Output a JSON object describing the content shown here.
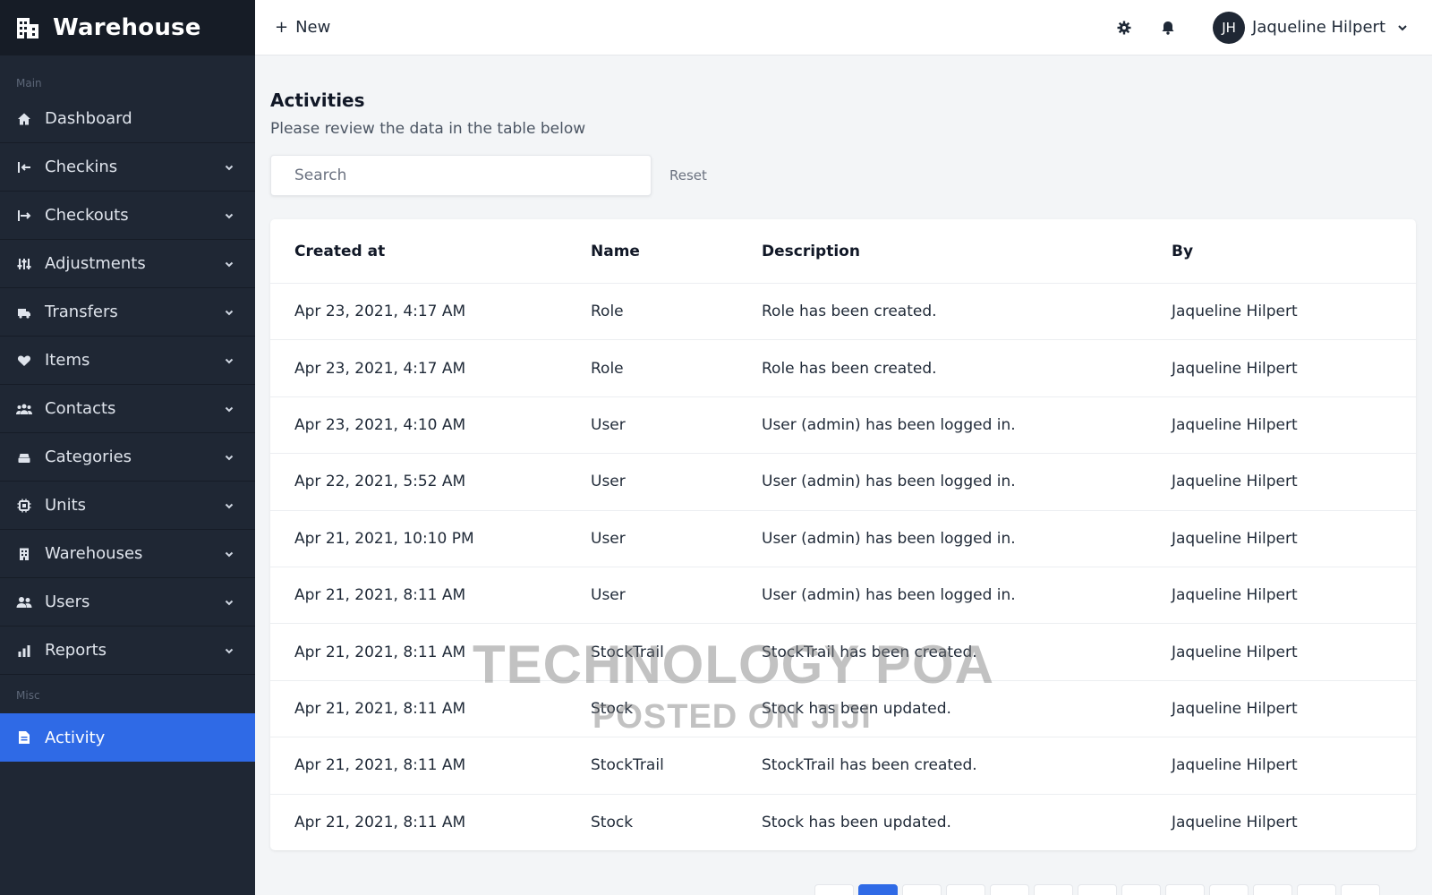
{
  "app": {
    "brand": "Warehouse"
  },
  "sidebar": {
    "sections": {
      "main": "Main",
      "misc": "Misc"
    },
    "items": [
      {
        "label": "Dashboard",
        "icon": "home-icon",
        "has_submenu": false
      },
      {
        "label": "Checkins",
        "icon": "checkin-icon",
        "has_submenu": true
      },
      {
        "label": "Checkouts",
        "icon": "checkout-icon",
        "has_submenu": true
      },
      {
        "label": "Adjustments",
        "icon": "sliders-icon",
        "has_submenu": true
      },
      {
        "label": "Transfers",
        "icon": "truck-icon",
        "has_submenu": true
      },
      {
        "label": "Items",
        "icon": "heart-icon",
        "has_submenu": true
      },
      {
        "label": "Contacts",
        "icon": "people-icon",
        "has_submenu": true
      },
      {
        "label": "Categories",
        "icon": "tray-icon",
        "has_submenu": true
      },
      {
        "label": "Units",
        "icon": "chip-icon",
        "has_submenu": true
      },
      {
        "label": "Warehouses",
        "icon": "building-icon",
        "has_submenu": true
      },
      {
        "label": "Users",
        "icon": "users-icon",
        "has_submenu": true
      },
      {
        "label": "Reports",
        "icon": "bar-chart-icon",
        "has_submenu": true
      }
    ],
    "misc_items": [
      {
        "label": "Activity",
        "icon": "document-icon",
        "active": true
      }
    ]
  },
  "topbar": {
    "new_label": "New",
    "user": {
      "initials": "JH",
      "name": "Jaqueline Hilpert"
    }
  },
  "page": {
    "title": "Activities",
    "subtitle": "Please review the data in the table below",
    "search_placeholder": "Search",
    "reset_label": "Reset"
  },
  "table": {
    "headers": [
      "Created at",
      "Name",
      "Description",
      "By"
    ],
    "rows": [
      [
        "Apr 23, 2021, 4:17 AM",
        "Role",
        "Role has been created.",
        "Jaqueline Hilpert"
      ],
      [
        "Apr 23, 2021, 4:17 AM",
        "Role",
        "Role has been created.",
        "Jaqueline Hilpert"
      ],
      [
        "Apr 23, 2021, 4:10 AM",
        "User",
        "User (admin) has been logged in.",
        "Jaqueline Hilpert"
      ],
      [
        "Apr 22, 2021, 5:52 AM",
        "User",
        "User (admin) has been logged in.",
        "Jaqueline Hilpert"
      ],
      [
        "Apr 21, 2021, 10:10 PM",
        "User",
        "User (admin) has been logged in.",
        "Jaqueline Hilpert"
      ],
      [
        "Apr 21, 2021, 8:11 AM",
        "User",
        "User (admin) has been logged in.",
        "Jaqueline Hilpert"
      ],
      [
        "Apr 21, 2021, 8:11 AM",
        "StockTrail",
        "StockTrail has been created.",
        "Jaqueline Hilpert"
      ],
      [
        "Apr 21, 2021, 8:11 AM",
        "Stock",
        "Stock has been updated.",
        "Jaqueline Hilpert"
      ],
      [
        "Apr 21, 2021, 8:11 AM",
        "StockTrail",
        "StockTrail has been created.",
        "Jaqueline Hilpert"
      ],
      [
        "Apr 21, 2021, 8:11 AM",
        "Stock",
        "Stock has been updated.",
        "Jaqueline Hilpert"
      ]
    ]
  },
  "watermark": {
    "line1": "TECHNOLOGY POA",
    "line2": "POSTED ON JIJI"
  },
  "colors": {
    "sidebar_bg": "#1f2734",
    "accent": "#2f6ae6",
    "page_bg": "#f3f5f7"
  }
}
